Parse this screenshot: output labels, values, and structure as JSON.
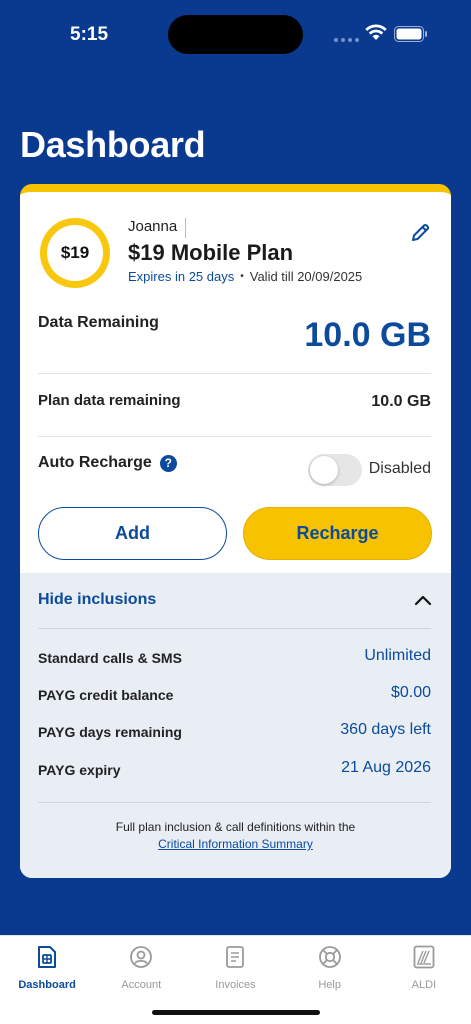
{
  "status": {
    "time": "5:15"
  },
  "page": {
    "title": "Dashboard"
  },
  "plan": {
    "badge_price": "$19",
    "owner": "Joanna",
    "name": "$19 Mobile Plan",
    "expires": "Expires in 25 days",
    "separator": "•",
    "valid_till": "Valid till 20/09/2025"
  },
  "data": {
    "remaining_label": "Data Remaining",
    "remaining_value": "10.0 GB",
    "plan_label": "Plan data remaining",
    "plan_value": "10.0 GB"
  },
  "auto_recharge": {
    "label": "Auto Recharge",
    "help": "?",
    "state": "Disabled",
    "enabled": false
  },
  "buttons": {
    "add": "Add",
    "recharge": "Recharge"
  },
  "inclusions": {
    "toggle_label": "Hide inclusions",
    "rows": [
      {
        "label": "Standard calls & SMS",
        "value": "Unlimited"
      },
      {
        "label": "PAYG credit balance",
        "value": "$0.00"
      },
      {
        "label": "PAYG days remaining",
        "value": "360 days left"
      },
      {
        "label": "PAYG expiry",
        "value": "21 Aug 2026"
      }
    ],
    "footnote": "Full plan inclusion & call definitions within the",
    "link": "Critical Information Summary"
  },
  "tabs": [
    {
      "label": "Dashboard",
      "icon": "sim-card-icon",
      "active": true
    },
    {
      "label": "Account",
      "icon": "person-icon",
      "active": false
    },
    {
      "label": "Invoices",
      "icon": "document-icon",
      "active": false
    },
    {
      "label": "Help",
      "icon": "lifebuoy-icon",
      "active": false
    },
    {
      "label": "ALDI",
      "icon": "aldi-logo-icon",
      "active": false
    }
  ],
  "colors": {
    "brand_blue": "#0a3a8f",
    "accent_yellow": "#f7c200",
    "link_blue": "#0b4a9c"
  }
}
